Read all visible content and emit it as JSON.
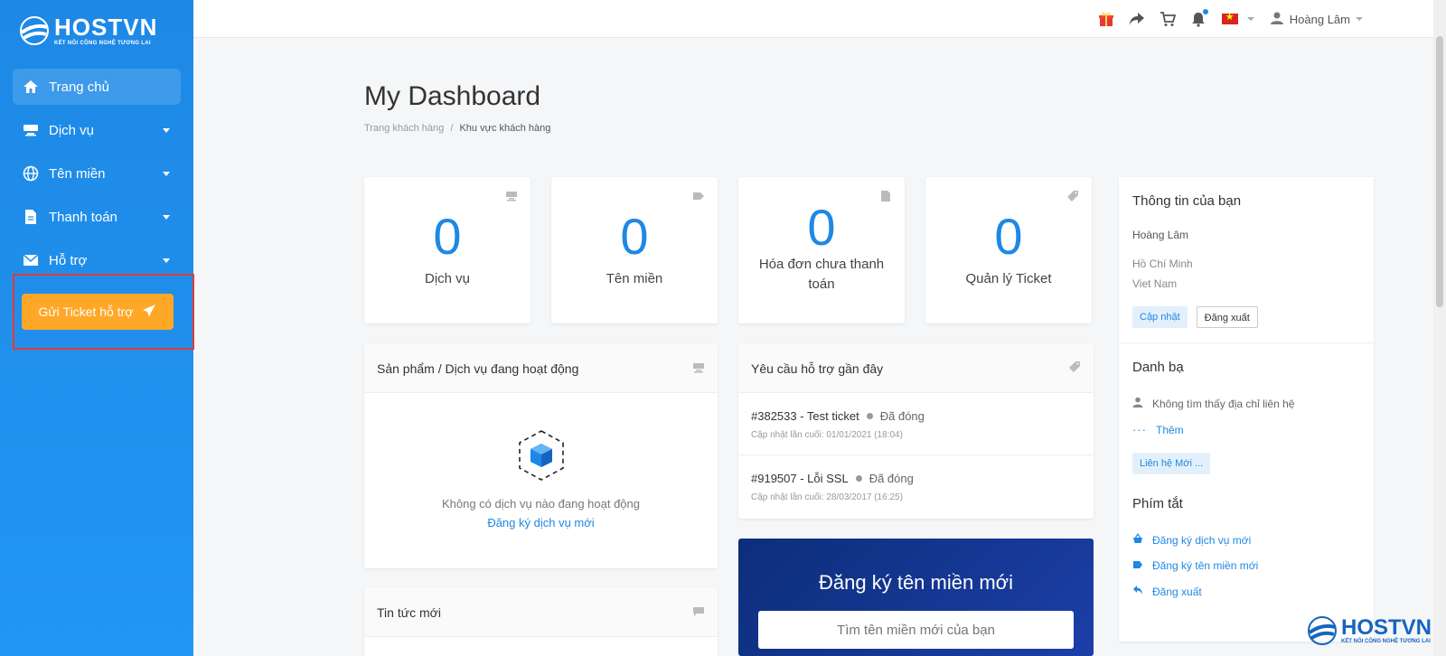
{
  "brand": {
    "name": "HOSTVN",
    "tagline": "KẾT NỐI CÔNG NGHỆ TƯƠNG LAI"
  },
  "sidebar": {
    "items": [
      {
        "label": "Trang chủ",
        "icon": "home-icon"
      },
      {
        "label": "Dịch vụ",
        "icon": "server-icon"
      },
      {
        "label": "Tên miền",
        "icon": "globe-icon"
      },
      {
        "label": "Thanh toán",
        "icon": "document-icon"
      },
      {
        "label": "Hỗ trợ",
        "icon": "mail-icon"
      }
    ],
    "ticket_button": "Gửi Ticket hỗ trợ"
  },
  "topbar": {
    "user_name": "Hoàng Lâm"
  },
  "page": {
    "title": "My Dashboard",
    "breadcrumb_root": "Trang khách hàng",
    "breadcrumb_sep": "/",
    "breadcrumb_current": "Khu vực khách hàng"
  },
  "stats": [
    {
      "value": "0",
      "label": "Dịch vụ"
    },
    {
      "value": "0",
      "label": "Tên miền"
    },
    {
      "value": "0",
      "label": "Hóa đơn chưa thanh toán"
    },
    {
      "value": "0",
      "label": "Quản lý Ticket"
    }
  ],
  "products_panel": {
    "title": "Sản phẩm / Dịch vụ đang hoạt động",
    "empty_text": "Không có dịch vụ nào đang hoạt động",
    "empty_link": "Đăng ký dịch vụ mới"
  },
  "news_panel": {
    "title": "Tin tức mới"
  },
  "support_panel": {
    "title": "Yêu cầu hỗ trợ gần đây",
    "tickets": [
      {
        "title": "#382533 - Test ticket",
        "status": "Đã đóng",
        "updated": "Cập nhật lần cuối: 01/01/2021 (18:04)"
      },
      {
        "title": "#919507 - Lỗi SSL",
        "status": "Đã đóng",
        "updated": "Cập nhật lần cuối: 28/03/2017 (16:25)"
      }
    ]
  },
  "domain_search": {
    "title": "Đăng ký tên miền mới",
    "placeholder": "Tìm tên miền mới của bạn"
  },
  "info": {
    "title": "Thông tin của bạn",
    "name": "Hoàng Lâm",
    "city": "Hồ Chí Minh",
    "country": "Viet Nam",
    "update_btn": "Cập nhật",
    "logout_btn": "Đăng xuất"
  },
  "contacts": {
    "title": "Danh bạ",
    "none": "Không tìm thấy địa chỉ liên hệ",
    "more": "Thêm",
    "new_btn": "Liên hệ Mới ..."
  },
  "shortcuts": {
    "title": "Phím tắt",
    "items": [
      {
        "label": "Đăng ký dịch vụ mới",
        "icon": "basket-icon"
      },
      {
        "label": "Đăng ký tên miền mới",
        "icon": "tag-icon"
      },
      {
        "label": "Đăng xuất",
        "icon": "reply-icon"
      }
    ]
  },
  "colors": {
    "sidebar": "#1e88e5",
    "accent": "#1e88e5",
    "ticket_button": "#ffa726",
    "domain_banner": "#0d2e7a",
    "highlight_border": "#e53935"
  }
}
